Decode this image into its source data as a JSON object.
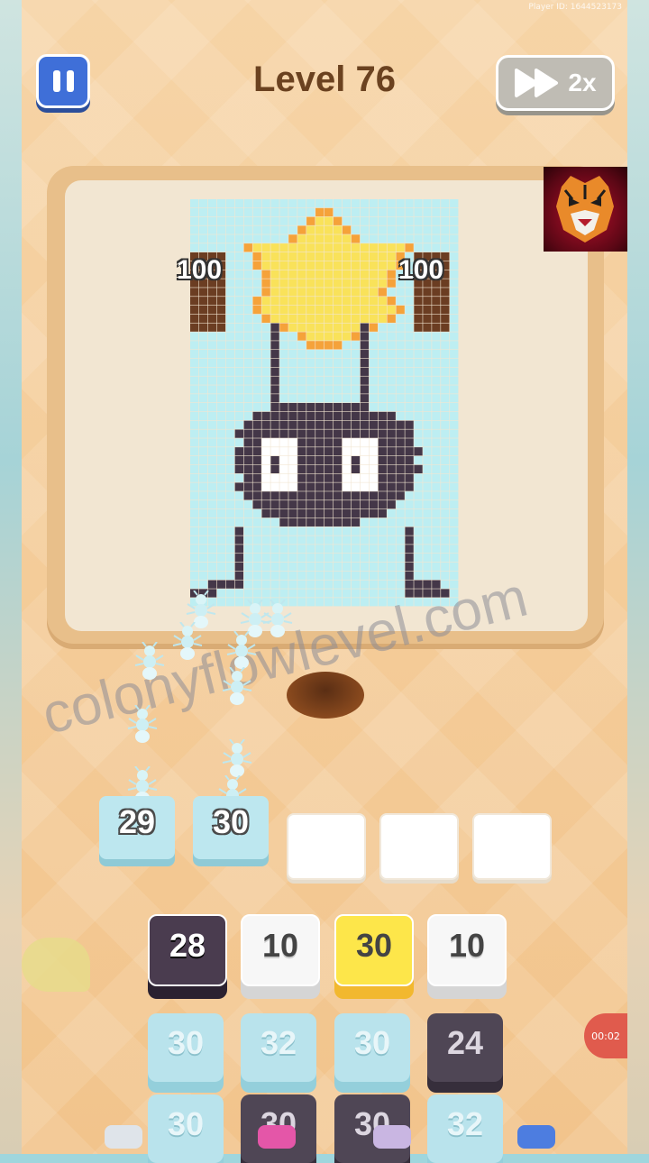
{
  "header": {
    "level_title": "Level 76",
    "speed_label": "2x",
    "player_id": "Player ID: 1644523173"
  },
  "board": {
    "bar_counts": [
      "100",
      "100"
    ],
    "pixel_colors": {
      "grid_bg": "#bdeef2",
      "star_yellow": "#f9e25a",
      "star_orange": "#f5a23a",
      "creature": "#443748",
      "eyes": "#ffffff",
      "chocolate": "#6b3d22"
    }
  },
  "watermark": "colonyflowlevel.com",
  "slots": [
    {
      "value": "29",
      "state": "filled"
    },
    {
      "value": "30",
      "state": "filled"
    },
    {
      "value": "",
      "state": "empty"
    },
    {
      "value": "",
      "state": "empty"
    },
    {
      "value": "",
      "state": "empty"
    }
  ],
  "tile_rows": [
    [
      {
        "value": "28",
        "color": "dark"
      },
      {
        "value": "10",
        "color": "white"
      },
      {
        "value": "30",
        "color": "yellow"
      },
      {
        "value": "10",
        "color": "white"
      }
    ],
    [
      {
        "value": "30",
        "color": "cyan"
      },
      {
        "value": "32",
        "color": "cyan"
      },
      {
        "value": "30",
        "color": "cyan"
      },
      {
        "value": "24",
        "color": "dark-dim"
      }
    ],
    [
      {
        "value": "30",
        "color": "cyan"
      },
      {
        "value": "30",
        "color": "dark-dim"
      },
      {
        "value": "30",
        "color": "dark-dim"
      },
      {
        "value": "32",
        "color": "cyan"
      }
    ]
  ],
  "timer": "00:02",
  "icons": [
    "pause-icon",
    "fast-forward-icon",
    "tiger-logo-icon",
    "ant-icon"
  ]
}
